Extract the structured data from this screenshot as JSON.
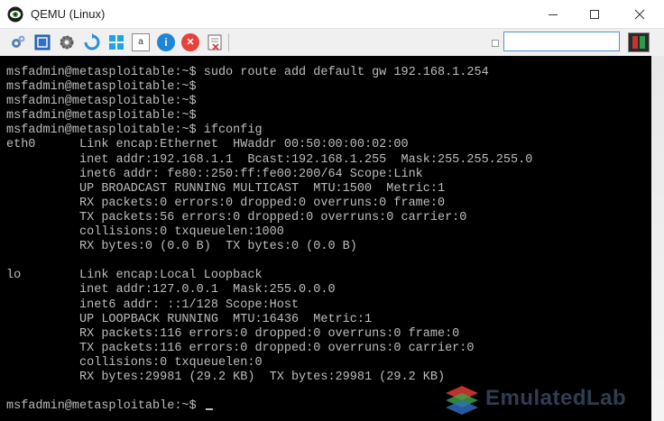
{
  "window": {
    "title": "QEMU (Linux)",
    "controls": {
      "minimize": "–",
      "maximize": "☐",
      "close": "✕"
    }
  },
  "toolbar": {
    "buttons": [
      {
        "icon": "network-gear-icon"
      },
      {
        "icon": "fullscreen-icon"
      },
      {
        "icon": "settings-gear-icon"
      },
      {
        "icon": "refresh-icon"
      },
      {
        "icon": "windows-logo-icon"
      },
      {
        "icon": "text-document-icon",
        "glyph": "a"
      },
      {
        "icon": "info-icon",
        "glyph": "i"
      },
      {
        "icon": "stop-icon",
        "glyph": "✕"
      },
      {
        "icon": "capture-icon"
      }
    ],
    "search": {
      "value": "",
      "placeholder": ""
    }
  },
  "colors": {
    "terminal_bg": "#000000",
    "terminal_text": "#bdbdbd",
    "accent": "#3a7fd5"
  },
  "terminal": {
    "lines": [
      "msfadmin@metasploitable:~$ sudo route add default gw 192.168.1.254",
      "msfadmin@metasploitable:~$",
      "msfadmin@metasploitable:~$",
      "msfadmin@metasploitable:~$",
      "msfadmin@metasploitable:~$ ifconfig",
      "eth0      Link encap:Ethernet  HWaddr 00:50:00:00:02:00",
      "          inet addr:192.168.1.1  Bcast:192.168.1.255  Mask:255.255.255.0",
      "          inet6 addr: fe80::250:ff:fe00:200/64 Scope:Link",
      "          UP BROADCAST RUNNING MULTICAST  MTU:1500  Metric:1",
      "          RX packets:0 errors:0 dropped:0 overruns:0 frame:0",
      "          TX packets:56 errors:0 dropped:0 overruns:0 carrier:0",
      "          collisions:0 txqueuelen:1000",
      "          RX bytes:0 (0.0 B)  TX bytes:0 (0.0 B)",
      "",
      "lo        Link encap:Local Loopback",
      "          inet addr:127.0.0.1  Mask:255.0.0.0",
      "          inet6 addr: ::1/128 Scope:Host",
      "          UP LOOPBACK RUNNING  MTU:16436  Metric:1",
      "          RX packets:116 errors:0 dropped:0 overruns:0 frame:0",
      "          TX packets:116 errors:0 dropped:0 overruns:0 carrier:0",
      "          collisions:0 txqueuelen:0",
      "          RX bytes:29981 (29.2 KB)  TX bytes:29981 (29.2 KB)",
      "",
      "msfadmin@metasploitable:~$ "
    ]
  },
  "watermark": {
    "text": "EmulatedLab"
  }
}
